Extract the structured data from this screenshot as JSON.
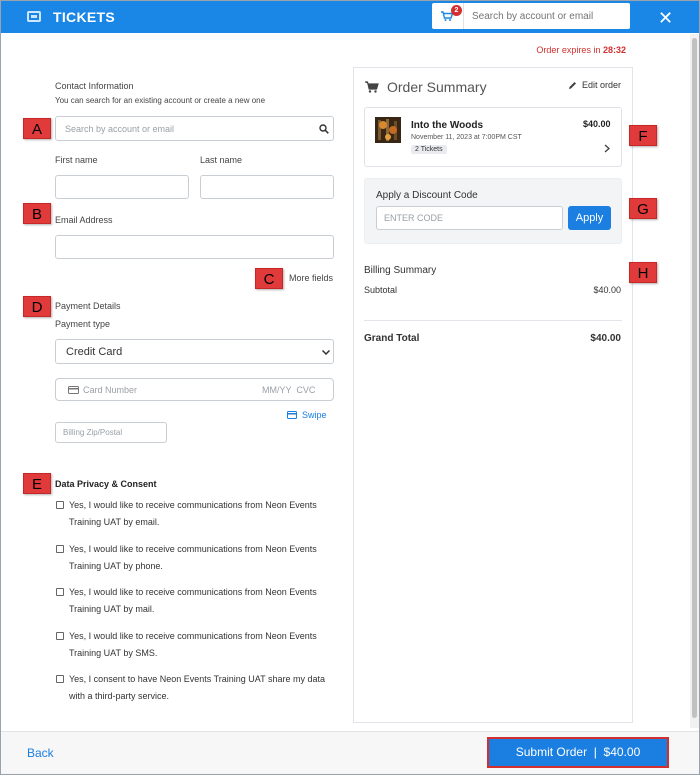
{
  "header": {
    "title": "TICKETS",
    "cart_count": "2",
    "search_placeholder": "Search by account or email"
  },
  "expires": {
    "label": "Order expires in",
    "time": "28:32"
  },
  "contact": {
    "title": "Contact Information",
    "subtitle": "You can search for an existing account or create a new one",
    "search_placeholder": "Search by account or email",
    "first_name_label": "First name",
    "last_name_label": "Last name",
    "email_label": "Email Address",
    "more_fields": "More fields"
  },
  "payment": {
    "title": "Payment Details",
    "type_label": "Payment type",
    "type_value": "Credit Card",
    "card_placeholder": "Card Number",
    "expiry_cvc": "MM/YY  CVC",
    "swipe": "Swipe",
    "zip_placeholder": "Billing Zip/Postal"
  },
  "privacy": {
    "title": "Data Privacy & Consent",
    "options": [
      {
        "line1": "Yes, I would like to receive communications from Neon Events",
        "line2": "Training UAT by email."
      },
      {
        "line1": "Yes, I would like to receive communications from Neon Events",
        "line2": "Training UAT by phone."
      },
      {
        "line1": "Yes, I would like to receive communications from Neon Events",
        "line2": "Training UAT by mail."
      },
      {
        "line1": "Yes, I would like to receive communications from Neon Events",
        "line2": "Training UAT by SMS."
      },
      {
        "line1": "Yes, I consent to have Neon Events Training UAT share my data",
        "line2": "with a third-party service."
      }
    ]
  },
  "order_summary": {
    "title": "Order Summary",
    "edit": "Edit order",
    "event_name": "Into the Woods",
    "event_date": "November 11, 2023 at 7:00PM CST",
    "tickets": "2 Tickets",
    "price": "$40.00"
  },
  "discount": {
    "title": "Apply a Discount Code",
    "placeholder": "ENTER CODE",
    "apply": "Apply"
  },
  "billing": {
    "title": "Billing Summary",
    "subtotal_label": "Subtotal",
    "subtotal_value": "$40.00",
    "grand_total_label": "Grand Total",
    "grand_total_value": "$40.00"
  },
  "footer": {
    "back": "Back",
    "submit": "Submit Order  |  $40.00"
  },
  "callouts": [
    "A",
    "B",
    "C",
    "D",
    "E",
    "F",
    "G",
    "H"
  ],
  "colors": {
    "brand": "#1a87e6",
    "button": "#1a7fe0",
    "alert": "#d32f2f",
    "callout": "#e13a3a"
  }
}
